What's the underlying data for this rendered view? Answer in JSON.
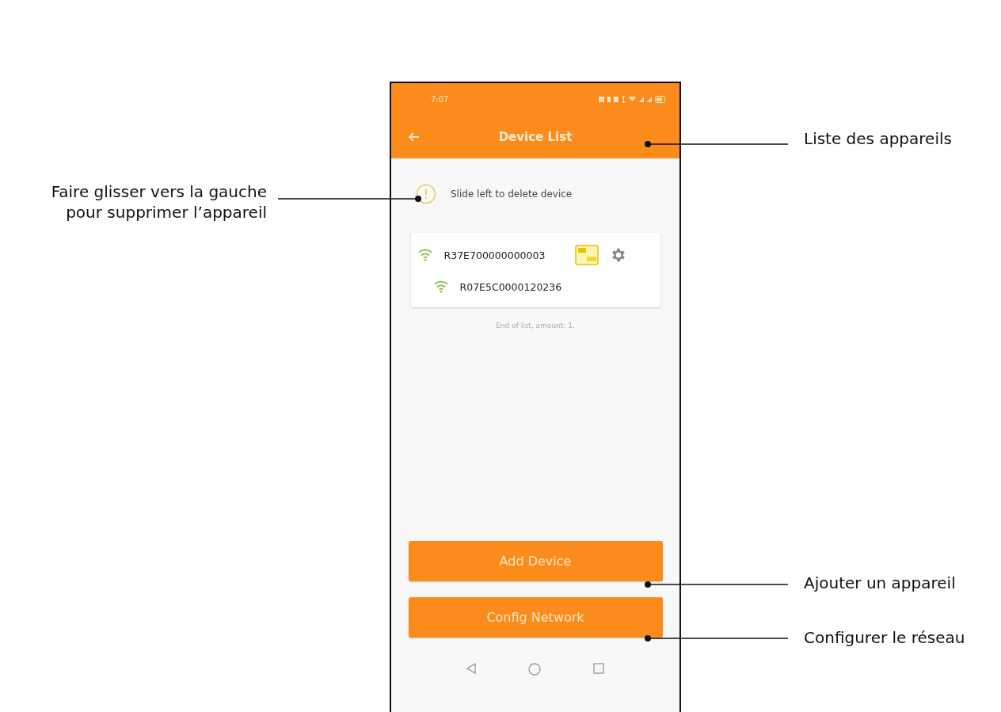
{
  "status_bar": {
    "time": "7:07"
  },
  "header": {
    "title": "Device List"
  },
  "hint": {
    "text": "Slide left to delete device"
  },
  "devices": [
    {
      "name": "R37E700000000003",
      "sim_badge": true,
      "settings": true,
      "children": [
        {
          "name": "R07E5C0000120236",
          "sim_badge": false,
          "settings": false
        }
      ]
    }
  ],
  "list_footer": "End of list, amount: 1.",
  "buttons": [
    {
      "label": "Add Device"
    },
    {
      "label": "Config Network"
    }
  ],
  "annotations": [
    {
      "kind": "header",
      "lines": [
        "Liste des appareils"
      ]
    },
    {
      "kind": "hint",
      "lines": [
        "Faire glisser vers la gauche",
        "pour supprimer l’appareil"
      ]
    },
    {
      "kind": "add",
      "lines": [
        "Ajouter un appareil"
      ]
    },
    {
      "kind": "config",
      "lines": [
        "Configurer le réseau"
      ]
    }
  ]
}
